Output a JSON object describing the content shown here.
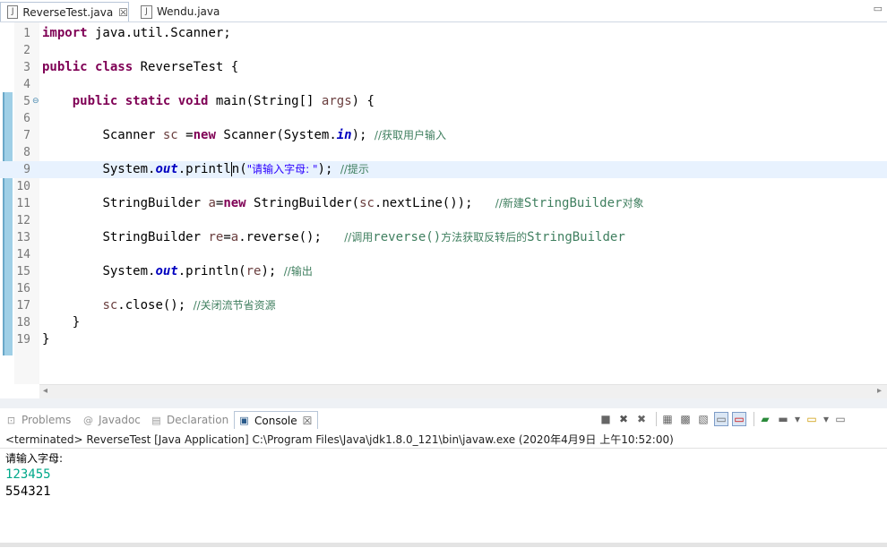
{
  "editor_tabs": [
    {
      "label": "ReverseTest.java",
      "active": true,
      "close": "☒"
    },
    {
      "label": "Wendu.java",
      "active": false
    }
  ],
  "code_lines": [
    {
      "n": "1"
    },
    {
      "n": "2"
    },
    {
      "n": "3"
    },
    {
      "n": "4"
    },
    {
      "n": "5"
    },
    {
      "n": "6"
    },
    {
      "n": "7"
    },
    {
      "n": "8"
    },
    {
      "n": "9"
    },
    {
      "n": "10"
    },
    {
      "n": "11"
    },
    {
      "n": "12"
    },
    {
      "n": "13"
    },
    {
      "n": "14"
    },
    {
      "n": "15"
    },
    {
      "n": "16"
    },
    {
      "n": "17"
    },
    {
      "n": "18"
    },
    {
      "n": "19"
    }
  ],
  "code": {
    "l1_kw": "import",
    "l1_rest": " java.util.Scanner;",
    "l3_kw1": "public",
    "l3_kw2": "class",
    "l3_rest": " ReverseTest {",
    "l5_kw1": "public",
    "l5_kw2": "static",
    "l5_kw3": "void",
    "l5_a": " main(String[] ",
    "l5_arg": "args",
    "l5_b": ") {",
    "l7_a": "Scanner ",
    "l7_var": "sc",
    "l7_b": " =",
    "l7_kw": "new",
    "l7_c": " Scanner(System.",
    "l7_in": "in",
    "l7_d": "); ",
    "l7_cm": "//获取用户输入",
    "l9_a": "System.",
    "l9_out": "out",
    "l9_b": ".printl",
    "l9_c": "n(",
    "l9_str": "\"请输入字母: \"",
    "l9_d": "); ",
    "l9_cm": "//提示",
    "l11_a": "StringBuilder ",
    "l11_var": "a",
    "l11_b": "=",
    "l11_kw": "new",
    "l11_c": " StringBuilder(",
    "l11_var2": "sc",
    "l11_d": ".nextLine());   ",
    "l11_cm1": "//新建",
    "l11_cm2": "StringBuilder",
    "l11_cm3": "对象",
    "l13_a": "StringBuilder ",
    "l13_var": "re",
    "l13_b": "=",
    "l13_var2": "a",
    "l13_c": ".reverse();   ",
    "l13_cm1": "//调用",
    "l13_cm2": "reverse()",
    "l13_cm3": "方法获取反转后的",
    "l13_cm4": "StringBuilder",
    "l15_a": "System.",
    "l15_out": "out",
    "l15_b": ".println(",
    "l15_var": "re",
    "l15_c": "); ",
    "l15_cm": "//输出",
    "l17_var": "sc",
    "l17_a": ".close(); ",
    "l17_cm": "//关闭流节省资源",
    "l18": "}",
    "l19": "}"
  },
  "view_tabs": [
    {
      "label": "Problems",
      "icon": "problems-icon"
    },
    {
      "label": "Javadoc",
      "icon": "at-icon"
    },
    {
      "label": "Declaration",
      "icon": "declaration-icon"
    },
    {
      "label": "Console",
      "icon": "console-icon",
      "active": true,
      "close": "☒"
    }
  ],
  "console": {
    "info": "<terminated> ReverseTest [Java Application] C:\\Program Files\\Java\\jdk1.8.0_121\\bin\\javaw.exe (2020年4月9日 上午10:52:00)",
    "lines": [
      {
        "text": "请输入字母:",
        "color": "#000000"
      },
      {
        "text": "123455",
        "color": "#00a88a"
      },
      {
        "text": "554321",
        "color": "#000000"
      }
    ]
  },
  "colors": {
    "keyword": "#7f0055",
    "comment": "#3f7f5f",
    "string": "#2a00ff",
    "static_field": "#0000c0",
    "local_var": "#6a3e3e",
    "current_line": "#e8f2fe"
  }
}
